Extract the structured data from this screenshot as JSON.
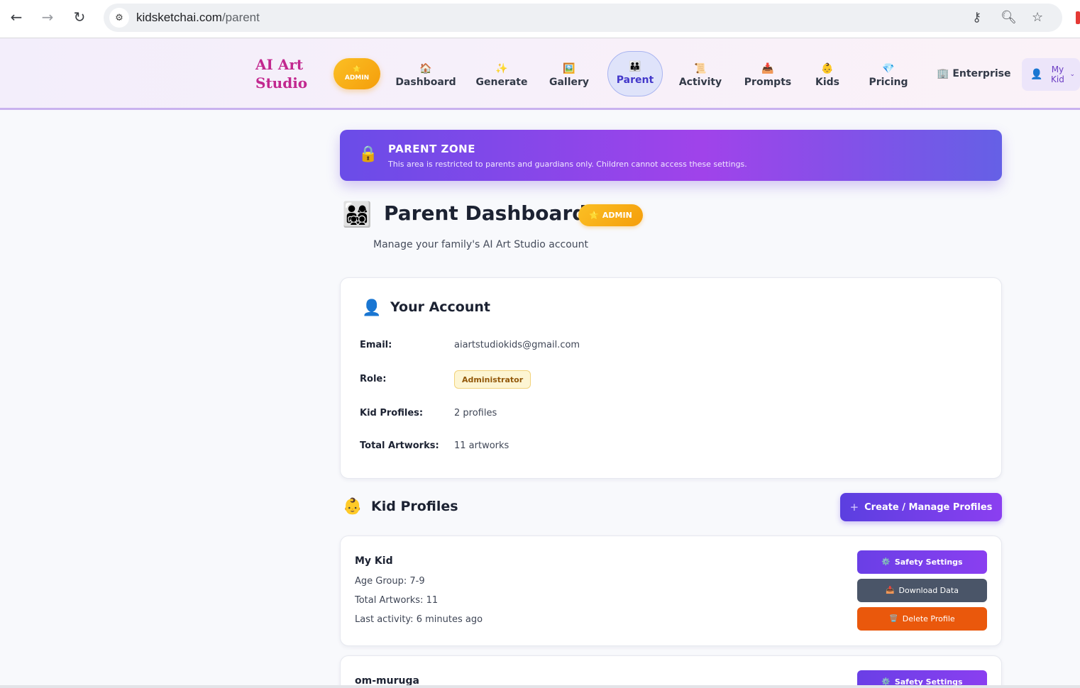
{
  "browser": {
    "url_domain": "kidsketchai.com",
    "url_path": "/parent",
    "back_icon": "arrow-left-icon",
    "forward_icon": "arrow-right-icon",
    "reload_icon": "reload-icon"
  },
  "header": {
    "brand": "AI Art Studio",
    "admin_pill_star": "⭐",
    "admin_pill_label": "ADMIN",
    "nav": [
      {
        "icon": "🏠",
        "label": "Dashboard"
      },
      {
        "icon": "✨",
        "label": "Generate"
      },
      {
        "icon": "🖼️",
        "label": "Gallery"
      },
      {
        "icon": "👪",
        "label": "Parent"
      },
      {
        "icon": "📜",
        "label": "Activity"
      },
      {
        "icon": "📥",
        "label": "Prompts"
      },
      {
        "icon": "👶",
        "label": "Kids"
      },
      {
        "icon": "💎",
        "label": "Pricing"
      }
    ],
    "active_nav": "Parent",
    "enterprise_icon": "🏢",
    "enterprise_label": "Enterprise",
    "profile_icon": "👤",
    "profile_label": "My Kid",
    "profile_chevron": "⌄"
  },
  "zone_banner": {
    "icon": "🔒",
    "title": "PARENT ZONE",
    "subtitle": "This area is restricted to parents and guardians only. Children cannot access these settings."
  },
  "page": {
    "icon": "👨‍👩‍👧‍👦",
    "title": "Parent Dashboard",
    "badge_star": "⭐",
    "badge": "ADMIN",
    "subtitle": "Manage your family's AI Art Studio account"
  },
  "account": {
    "icon": "👤",
    "title": "Your Account",
    "email_label": "Email:",
    "email_value": "aiartstudiokids@gmail.com",
    "role_label": "Role:",
    "role_value": "Administrator",
    "profiles_label": "Kid Profiles:",
    "profiles_value": "2 profiles",
    "artworks_label": "Total Artworks:",
    "artworks_value": "11 artworks"
  },
  "kid_profiles": {
    "icon": "👶",
    "title": "Kid Profiles",
    "create_plus": "+",
    "create_label": "Create / Manage Profiles",
    "items": [
      {
        "name": "My Kid",
        "age_group": "Age Group: 7-9",
        "artworks": "Total Artworks: 11",
        "last_activity": "Last activity: 6 minutes ago",
        "safety_label": "Safety Settings",
        "download_label": "Download Data",
        "delete_label": "Delete Profile"
      },
      {
        "name": "om-muruga",
        "safety_label": "Safety Settings"
      }
    ],
    "safety_icon": "⚙️",
    "download_icon": "📥",
    "delete_icon": "🗑️"
  }
}
